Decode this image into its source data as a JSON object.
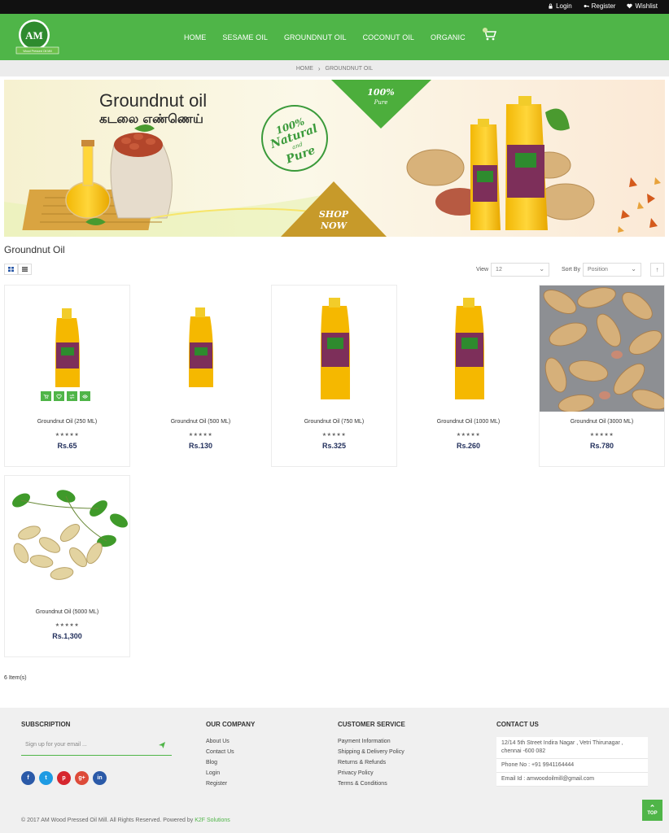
{
  "topbar": {
    "login": "Login",
    "register": "Register",
    "wishlist": "Wishlist"
  },
  "logo": {
    "letters": "AM",
    "ribbon": "Wood Pressed Oil Mill"
  },
  "nav": [
    "HOME",
    "SESAME OIL",
    "GROUNDNUT OIL",
    "COCONUT OIL",
    "ORGANIC"
  ],
  "breadcrumb": {
    "home": "HOME",
    "current": "GROUNDNUT OIL"
  },
  "banner": {
    "title_en": "Groundnut oil",
    "title_ta": "கடலை எண்ணெய்",
    "badge_line1": "100%",
    "badge_line2": "Natural",
    "badge_line3": "and",
    "badge_line4": "Pure",
    "corner_top1": "100%",
    "corner_top2": "Pure",
    "shop1": "SHOP",
    "shop2": "NOW"
  },
  "page_title": "Groundnut Oil",
  "toolbar": {
    "view_label": "View",
    "view_value": "12",
    "sort_label": "Sort By",
    "sort_value": "Position",
    "sort_dir": "↑"
  },
  "products": [
    {
      "name": "Groundnut Oil (250 ML)",
      "price": "Rs.65",
      "stars": "★★★★★"
    },
    {
      "name": "Groundnut Oil (500 ML)",
      "price": "Rs.130",
      "stars": "★★★★★"
    },
    {
      "name": "Groundnut Oil (750 ML)",
      "price": "Rs.325",
      "stars": "★★★★★"
    },
    {
      "name": "Groundnut Oil (1000 ML)",
      "price": "Rs.260",
      "stars": "★★★★★"
    },
    {
      "name": "Groundnut Oil (3000 ML)",
      "price": "Rs.780",
      "stars": "★★★★★"
    },
    {
      "name": "Groundnut Oil (5000 ML)",
      "price": "Rs.1,300",
      "stars": "★★★★★"
    }
  ],
  "item_count": "6 Item(s)",
  "footer": {
    "subscription": {
      "heading": "SUBSCRIPTION",
      "placeholder": "Sign up for your email ...",
      "socials": [
        "f",
        "t",
        "p",
        "g+",
        "in"
      ]
    },
    "company": {
      "heading": "OUR COMPANY",
      "links": [
        "About Us",
        "Contact Us",
        "Blog",
        "Login",
        "Register"
      ]
    },
    "service": {
      "heading": "CUSTOMER SERVICE",
      "links": [
        "Payment Information",
        "Shipping & Delivery Policy",
        "Returns & Refunds",
        "Privacy Policy",
        "Terms & Conditions"
      ]
    },
    "contact": {
      "heading": "CONTACT US",
      "address": "12/14 5th Street Indira Nagar , Vetri Thirunagar , chennai -600 082",
      "phone": "Phone No : +91 9941164444",
      "email": "Email Id : amwoodoilmill@gmail.com"
    },
    "copyright": "© 2017 AM Wood Pressed Oil Mill. All Rights Reserved. Powered by",
    "powered_by": "K2F Solutions"
  },
  "top_button": "TOP",
  "colors": {
    "brand_green": "#4fb548",
    "price_navy": "#1f2d5a",
    "topbar": "#111111"
  }
}
